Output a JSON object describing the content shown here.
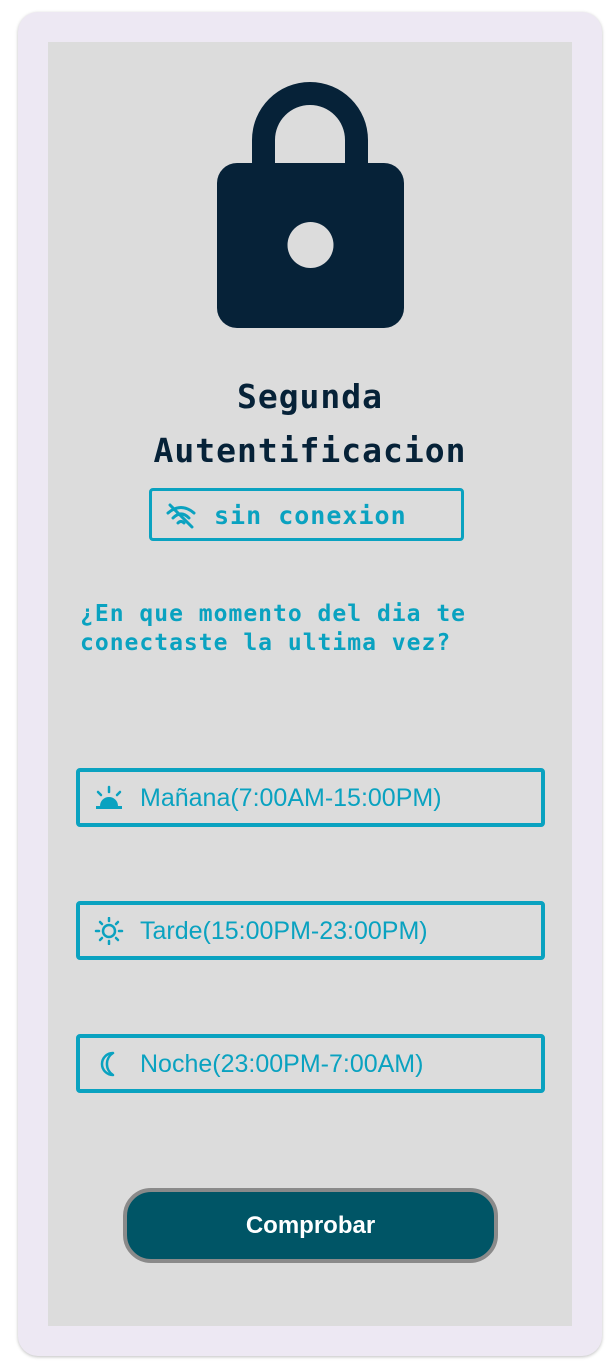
{
  "title_line1": "Segunda",
  "title_line2": "Autentificacion",
  "connection_status": {
    "icon": "wifi-off-icon",
    "label": "sin conexion"
  },
  "question": "¿En que momento del dia te conectaste la ultima vez?",
  "options": [
    {
      "icon": "sunrise-icon",
      "label": "Mañana(7:00AM-15:00PM)"
    },
    {
      "icon": "sun-icon",
      "label": "Tarde(15:00PM-23:00PM)"
    },
    {
      "icon": "moon-icon",
      "label": "Noche(23:00PM-7:00AM)"
    }
  ],
  "submit_label": "Comprobar",
  "colors": {
    "primary_dark": "#062238",
    "accent": "#0aa2c0",
    "button_bg": "#005566",
    "panel_bg": "#dcdcdc",
    "frame_bg": "#ede8f3"
  }
}
